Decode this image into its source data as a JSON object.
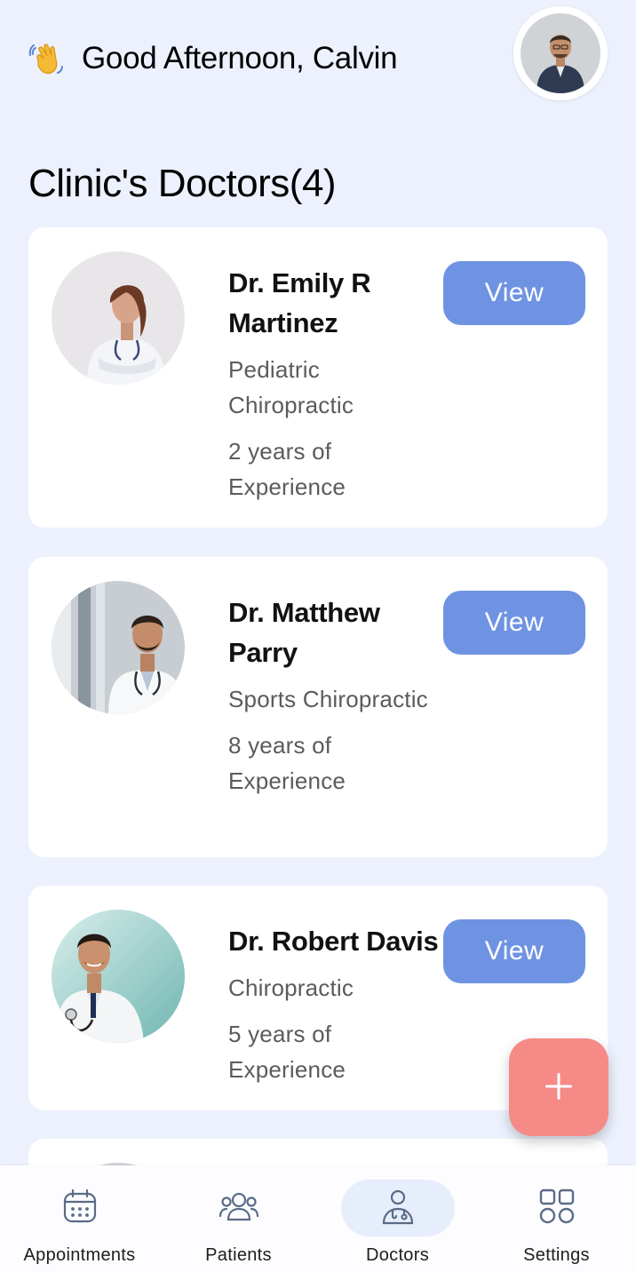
{
  "header": {
    "greeting_emoji": "waving-hand",
    "greeting": "Good Afternoon, Calvin",
    "avatar": "user-avatar"
  },
  "section": {
    "title": "Clinic's Doctors(4)"
  },
  "doctors": [
    {
      "name": "Dr. Emily R Martinez",
      "specialty": "Pediatric Chiropractic",
      "experience": "2 years of Experience",
      "view_label": "View"
    },
    {
      "name": "Dr. Matthew Parry",
      "specialty": "Sports Chiropractic",
      "experience": "8 years of Experience",
      "view_label": "View"
    },
    {
      "name": "Dr. Robert Davis",
      "specialty": "Chiropractic",
      "experience": "5 years of Experience",
      "view_label": "View"
    }
  ],
  "fab": {
    "icon": "plus-icon"
  },
  "nav": {
    "items": [
      {
        "label": "Appointments",
        "icon": "calendar-icon",
        "active": false
      },
      {
        "label": "Patients",
        "icon": "patients-icon",
        "active": false
      },
      {
        "label": "Doctors",
        "icon": "doctor-icon",
        "active": true
      },
      {
        "label": "Settings",
        "icon": "grid-icon",
        "active": false
      }
    ]
  },
  "colors": {
    "background": "#ecf1fd",
    "card": "#ffffff",
    "view_button": "#6f93e3",
    "fab": "#f58a87",
    "nav_icon": "#5b6b86",
    "nav_active_bg": "#e6edfb"
  }
}
